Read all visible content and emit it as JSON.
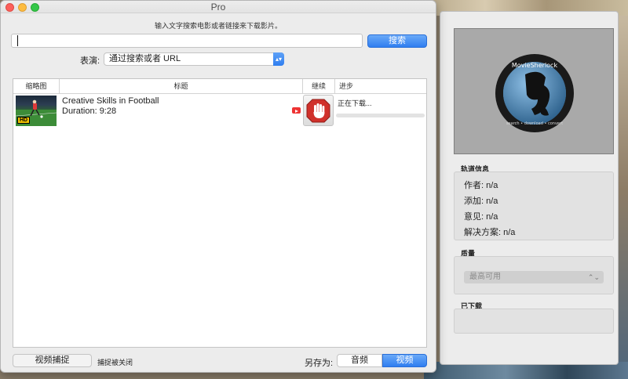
{
  "window": {
    "title": "Pro",
    "hint": "输入文字搜索电影或者链接来下载影片。"
  },
  "search": {
    "value": "",
    "placeholder": "",
    "button_label": "搜索"
  },
  "mode": {
    "label": "表演:",
    "selected": "通过搜索或者 URL"
  },
  "table": {
    "columns": {
      "thumbnail": "缩略图",
      "title": "标题",
      "continue": "继续",
      "progress": "进步"
    },
    "rows": [
      {
        "title": "Creative Skills in Football",
        "duration": "Duration: 9:28",
        "thumbnail_badge": "HD",
        "status": "正在下载...",
        "progress_fraction": 0.0,
        "source_icon": "youtube-icon",
        "action_icon": "stop-hand-icon"
      }
    ]
  },
  "bottom": {
    "capture_button": "视频捕捉",
    "capture_status": "捕捉被关闭",
    "saveas_label": "另存为:",
    "audio_label": "音频",
    "video_label": "视频",
    "selected": "视频"
  },
  "side": {
    "logo_text": "MovieSherlock",
    "logo_subtext": "search • download • convert",
    "track_info_label": "轨道信息",
    "author": "作者: n/a",
    "added": "添加: n/a",
    "comments": "意见: n/a",
    "resolution": "解决方案: n/a",
    "quality_label": "质量",
    "quality_selected": "最高可用",
    "downloaded_label": "已下载"
  },
  "colors": {
    "accent": "#2f7ef0",
    "close": "#fc605c",
    "minimize": "#fdbc40",
    "maximize": "#34c749",
    "stop": "#d0302a"
  }
}
